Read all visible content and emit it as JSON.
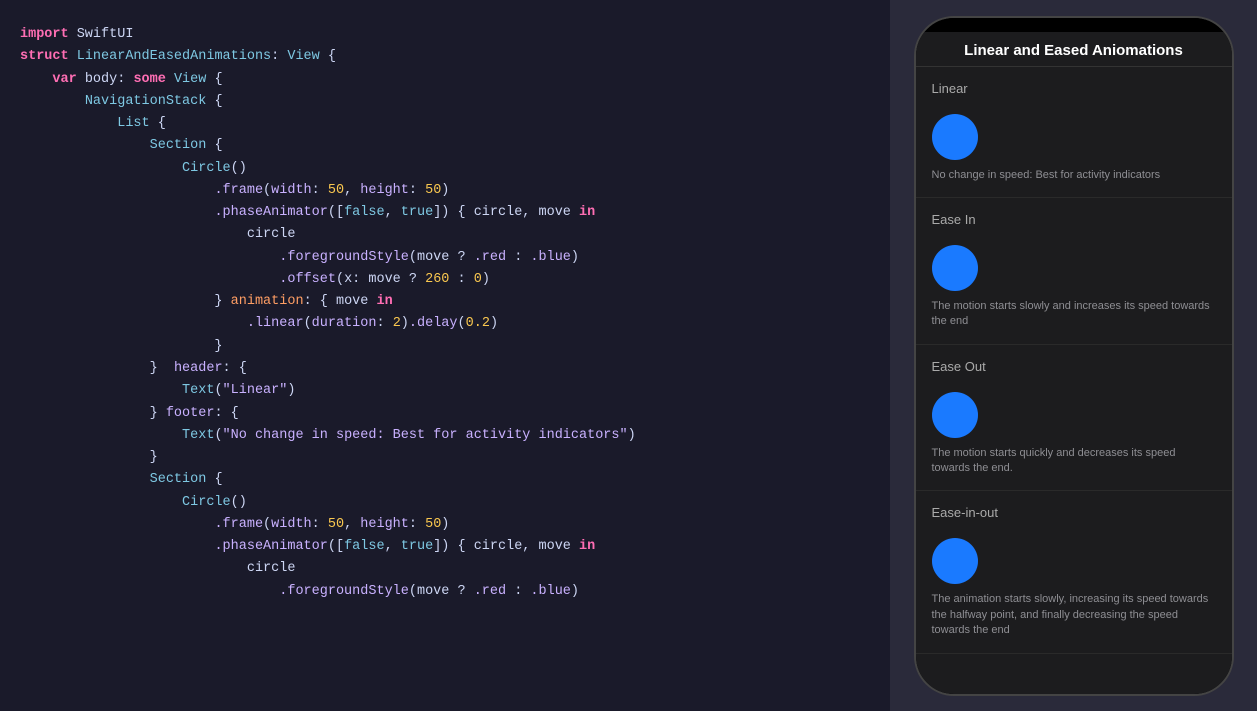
{
  "code": {
    "lines": [
      {
        "id": 1,
        "tokens": [
          {
            "t": "kw-import",
            "v": "import"
          },
          {
            "t": "normal",
            "v": " SwiftUI"
          }
        ]
      },
      {
        "id": 2,
        "tokens": [
          {
            "t": "normal",
            "v": ""
          }
        ]
      },
      {
        "id": 3,
        "tokens": [
          {
            "t": "kw-struct",
            "v": "struct"
          },
          {
            "t": "normal",
            "v": " "
          },
          {
            "t": "type-name",
            "v": "LinearAndEasedAnimations"
          },
          {
            "t": "normal",
            "v": ": "
          },
          {
            "t": "type-name",
            "v": "View"
          },
          {
            "t": "normal",
            "v": " {"
          }
        ]
      },
      {
        "id": 4,
        "tokens": [
          {
            "t": "normal",
            "v": "    "
          },
          {
            "t": "kw-var",
            "v": "var"
          },
          {
            "t": "normal",
            "v": " body: "
          },
          {
            "t": "kw-some",
            "v": "some"
          },
          {
            "t": "normal",
            "v": " "
          },
          {
            "t": "type-name",
            "v": "View"
          },
          {
            "t": "normal",
            "v": " {"
          }
        ]
      },
      {
        "id": 5,
        "tokens": [
          {
            "t": "normal",
            "v": "        "
          },
          {
            "t": "type-name",
            "v": "NavigationStack"
          },
          {
            "t": "normal",
            "v": " {"
          }
        ]
      },
      {
        "id": 6,
        "tokens": [
          {
            "t": "normal",
            "v": "            "
          },
          {
            "t": "type-name",
            "v": "List"
          },
          {
            "t": "normal",
            "v": " {"
          }
        ]
      },
      {
        "id": 7,
        "tokens": [
          {
            "t": "normal",
            "v": "                "
          },
          {
            "t": "type-name",
            "v": "Section"
          },
          {
            "t": "normal",
            "v": " {"
          }
        ]
      },
      {
        "id": 8,
        "tokens": [
          {
            "t": "normal",
            "v": "                    "
          },
          {
            "t": "type-name",
            "v": "Circle"
          },
          {
            "t": "normal",
            "v": "()"
          }
        ]
      },
      {
        "id": 9,
        "tokens": [
          {
            "t": "normal",
            "v": "                        "
          },
          {
            "t": "method",
            "v": ".frame"
          },
          {
            "t": "normal",
            "v": "("
          },
          {
            "t": "prop",
            "v": "width"
          },
          {
            "t": "normal",
            "v": ": "
          },
          {
            "t": "num",
            "v": "50"
          },
          {
            "t": "normal",
            "v": ", "
          },
          {
            "t": "prop",
            "v": "height"
          },
          {
            "t": "normal",
            "v": ": "
          },
          {
            "t": "num",
            "v": "50"
          },
          {
            "t": "normal",
            "v": ")"
          }
        ]
      },
      {
        "id": 10,
        "tokens": [
          {
            "t": "normal",
            "v": "                        "
          },
          {
            "t": "method",
            "v": ".phaseAnimator"
          },
          {
            "t": "normal",
            "v": "(["
          },
          {
            "t": "kw-false",
            "v": "false"
          },
          {
            "t": "normal",
            "v": ", "
          },
          {
            "t": "kw-true",
            "v": "true"
          },
          {
            "t": "normal",
            "v": "]) { circle, move "
          },
          {
            "t": "kw-in",
            "v": "in"
          }
        ]
      },
      {
        "id": 11,
        "tokens": [
          {
            "t": "normal",
            "v": "                            circle"
          }
        ]
      },
      {
        "id": 12,
        "tokens": [
          {
            "t": "normal",
            "v": "                                "
          },
          {
            "t": "method",
            "v": ".foregroundStyle"
          },
          {
            "t": "normal",
            "v": "(move ? "
          },
          {
            "t": "prop",
            "v": ".red"
          },
          {
            "t": "normal",
            "v": " : "
          },
          {
            "t": "prop",
            "v": ".blue"
          },
          {
            "t": "normal",
            "v": ")"
          }
        ]
      },
      {
        "id": 13,
        "tokens": [
          {
            "t": "normal",
            "v": "                                "
          },
          {
            "t": "method",
            "v": ".offset"
          },
          {
            "t": "normal",
            "v": "(x: move ? "
          },
          {
            "t": "num",
            "v": "260"
          },
          {
            "t": "normal",
            "v": " : "
          },
          {
            "t": "num",
            "v": "0"
          },
          {
            "t": "normal",
            "v": ")"
          }
        ]
      },
      {
        "id": 14,
        "tokens": [
          {
            "t": "normal",
            "v": "                        } "
          },
          {
            "t": "kw-animation",
            "v": "animation"
          },
          {
            "t": "normal",
            "v": ": { move "
          },
          {
            "t": "kw-in",
            "v": "in"
          }
        ]
      },
      {
        "id": 15,
        "tokens": [
          {
            "t": "normal",
            "v": "                            "
          },
          {
            "t": "method",
            "v": ".linear"
          },
          {
            "t": "normal",
            "v": "("
          },
          {
            "t": "prop",
            "v": "duration"
          },
          {
            "t": "normal",
            "v": ": "
          },
          {
            "t": "num",
            "v": "2"
          },
          {
            "t": "normal",
            "v": ")"
          },
          {
            "t": "method",
            "v": ".delay"
          },
          {
            "t": "normal",
            "v": "("
          },
          {
            "t": "num",
            "v": "0.2"
          },
          {
            "t": "normal",
            "v": ")"
          }
        ]
      },
      {
        "id": 16,
        "tokens": [
          {
            "t": "normal",
            "v": "                        }"
          }
        ]
      },
      {
        "id": 17,
        "tokens": [
          {
            "t": "normal",
            "v": ""
          }
        ]
      },
      {
        "id": 18,
        "tokens": [
          {
            "t": "normal",
            "v": "                }  "
          },
          {
            "t": "prop",
            "v": "header"
          },
          {
            "t": "normal",
            "v": ": {"
          }
        ]
      },
      {
        "id": 19,
        "tokens": [
          {
            "t": "normal",
            "v": "                    "
          },
          {
            "t": "type-name",
            "v": "Text"
          },
          {
            "t": "normal",
            "v": "("
          },
          {
            "t": "str",
            "v": "\"Linear\""
          },
          {
            "t": "normal",
            "v": ")"
          }
        ]
      },
      {
        "id": 20,
        "tokens": [
          {
            "t": "normal",
            "v": "                } "
          },
          {
            "t": "prop",
            "v": "footer"
          },
          {
            "t": "normal",
            "v": ": {"
          }
        ]
      },
      {
        "id": 21,
        "tokens": [
          {
            "t": "normal",
            "v": "                    "
          },
          {
            "t": "type-name",
            "v": "Text"
          },
          {
            "t": "normal",
            "v": "("
          },
          {
            "t": "str",
            "v": "\"No change in speed: Best for activity indicators\""
          },
          {
            "t": "normal",
            "v": ")"
          }
        ]
      },
      {
        "id": 22,
        "tokens": [
          {
            "t": "normal",
            "v": "                }"
          }
        ]
      },
      {
        "id": 23,
        "tokens": [
          {
            "t": "normal",
            "v": ""
          }
        ]
      },
      {
        "id": 24,
        "tokens": [
          {
            "t": "normal",
            "v": "                "
          },
          {
            "t": "type-name",
            "v": "Section"
          },
          {
            "t": "normal",
            "v": " {"
          }
        ]
      },
      {
        "id": 25,
        "tokens": [
          {
            "t": "normal",
            "v": "                    "
          },
          {
            "t": "type-name",
            "v": "Circle"
          },
          {
            "t": "normal",
            "v": "()"
          }
        ]
      },
      {
        "id": 26,
        "tokens": [
          {
            "t": "normal",
            "v": "                        "
          },
          {
            "t": "method",
            "v": ".frame"
          },
          {
            "t": "normal",
            "v": "("
          },
          {
            "t": "prop",
            "v": "width"
          },
          {
            "t": "normal",
            "v": ": "
          },
          {
            "t": "num",
            "v": "50"
          },
          {
            "t": "normal",
            "v": ", "
          },
          {
            "t": "prop",
            "v": "height"
          },
          {
            "t": "normal",
            "v": ": "
          },
          {
            "t": "num",
            "v": "50"
          },
          {
            "t": "normal",
            "v": ")"
          }
        ]
      },
      {
        "id": 27,
        "tokens": [
          {
            "t": "normal",
            "v": "                        "
          },
          {
            "t": "method",
            "v": ".phaseAnimator"
          },
          {
            "t": "normal",
            "v": "(["
          },
          {
            "t": "kw-false",
            "v": "false"
          },
          {
            "t": "normal",
            "v": ", "
          },
          {
            "t": "kw-true",
            "v": "true"
          },
          {
            "t": "normal",
            "v": "]) { circle, move "
          },
          {
            "t": "kw-in",
            "v": "in"
          }
        ]
      },
      {
        "id": 28,
        "tokens": [
          {
            "t": "normal",
            "v": "                            circle"
          }
        ]
      },
      {
        "id": 29,
        "tokens": [
          {
            "t": "normal",
            "v": "                                "
          },
          {
            "t": "method",
            "v": ".foregroundStyle"
          },
          {
            "t": "normal",
            "v": "(move ? "
          },
          {
            "t": "prop",
            "v": ".red"
          },
          {
            "t": "normal",
            "v": " : "
          },
          {
            "t": "prop",
            "v": ".blue"
          },
          {
            "t": "normal",
            "v": ")"
          }
        ]
      }
    ]
  },
  "phone": {
    "title": "Linear and Eased Aniomations",
    "sections": [
      {
        "header": "Linear",
        "items": [
          {
            "desc": "No change in speed: Best for activity indicators"
          }
        ]
      },
      {
        "header": "Ease In",
        "items": [
          {
            "desc": "The motion starts slowly and increases its speed towards the end"
          }
        ]
      },
      {
        "header": "Ease Out",
        "items": [
          {
            "desc": "The motion starts quickly and decreases its speed towards the end."
          }
        ]
      },
      {
        "header": "Ease-in-out",
        "items": [
          {
            "desc": "The animation starts slowly, increasing its speed towards the halfway point, and finally decreasing the speed towards the end"
          }
        ]
      }
    ]
  }
}
